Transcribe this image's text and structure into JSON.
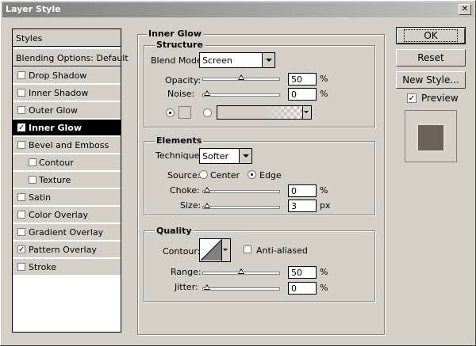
{
  "window": {
    "title": "Layer Style",
    "close": "✕"
  },
  "sidebar": {
    "items": [
      {
        "label": "Styles",
        "checked": null
      },
      {
        "label": "Blending Options: Default",
        "checked": null
      },
      {
        "label": "Drop Shadow",
        "checked": false
      },
      {
        "label": "Inner Shadow",
        "checked": false
      },
      {
        "label": "Outer Glow",
        "checked": false
      },
      {
        "label": "Inner Glow",
        "checked": true,
        "selected": true
      },
      {
        "label": "Bevel and Emboss",
        "checked": false
      },
      {
        "label": "Contour",
        "checked": false
      },
      {
        "label": "Texture",
        "checked": false
      },
      {
        "label": "Satin",
        "checked": false
      },
      {
        "label": "Color Overlay",
        "checked": false
      },
      {
        "label": "Gradient Overlay",
        "checked": false
      },
      {
        "label": "Pattern Overlay",
        "checked": true
      },
      {
        "label": "Stroke",
        "checked": false
      }
    ]
  },
  "panel": {
    "title": "Inner Glow",
    "structure": {
      "title": "Structure",
      "blend_mode_label": "Blend Mode:",
      "blend_mode_value": "Screen",
      "opacity_label": "Opacity:",
      "opacity_value": "50",
      "opacity_level": 50,
      "noise_label": "Noise:",
      "noise_value": "0",
      "noise_level": 0,
      "percent": "%"
    },
    "elements": {
      "title": "Elements",
      "technique_label": "Technique:",
      "technique_value": "Softer",
      "source_label": "Source:",
      "source_center": "Center",
      "source_edge": "Edge",
      "choke_label": "Choke:",
      "choke_value": "0",
      "choke_level": 0,
      "size_label": "Size:",
      "size_value": "3",
      "size_unit": "px",
      "percent": "%"
    },
    "quality": {
      "title": "Quality",
      "contour_label": "Contour:",
      "anti_aliased": "Anti-aliased",
      "range_label": "Range:",
      "range_value": "50",
      "range_level": 50,
      "jitter_label": "Jitter:",
      "jitter_value": "0",
      "jitter_level": 0,
      "percent": "%"
    }
  },
  "buttons": {
    "ok": "OK",
    "reset": "Reset",
    "new_style": "New Style...",
    "preview": "Preview"
  },
  "colors": {
    "preview_fill": "#6b635b",
    "selected_bg": "#000000",
    "dialog_bg": "#d4d0c8"
  }
}
